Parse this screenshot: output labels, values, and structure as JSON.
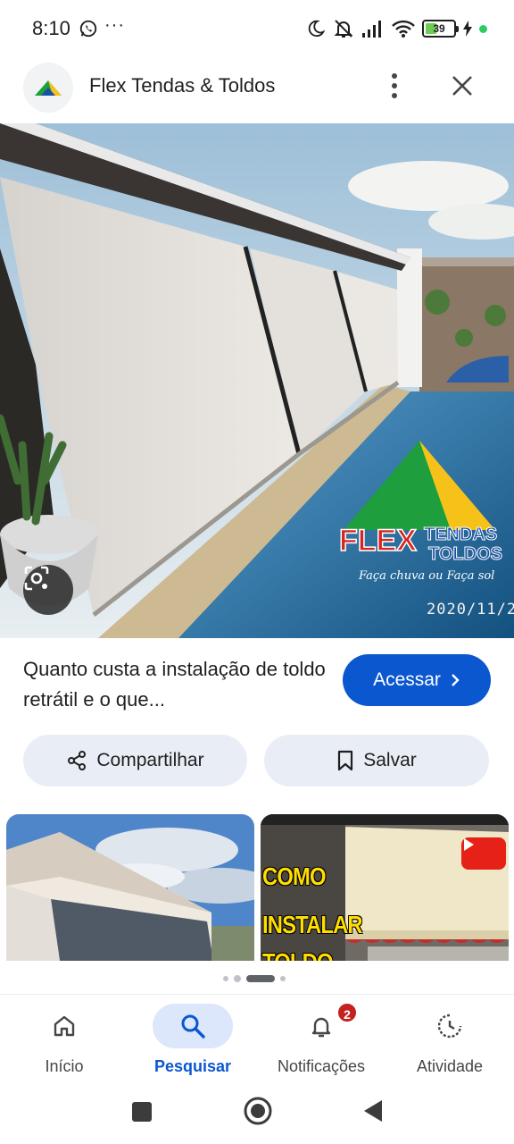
{
  "status_bar": {
    "time": "8:10",
    "more": "···",
    "battery_level": "39",
    "battery_fraction": 0.39
  },
  "header": {
    "title": "Flex Tendas & Toldos",
    "logo_icon": "flex-tendas-logo",
    "menu_icon": "more-vert-icon",
    "close_icon": "close-icon"
  },
  "hero": {
    "date_stamp": "2020/11/2",
    "watermark_text": "FLEX TENDAS & TOLDOS — Faça chuva ou Faça sol",
    "lens_icon": "lens-search-icon"
  },
  "result": {
    "caption": "Quanto custa a instalação de toldo retrátil e o que...",
    "visit_label": "Acessar",
    "visit_icon": "chevron-right-icon"
  },
  "actions": {
    "share_label": "Compartilhar",
    "save_label": "Salvar"
  },
  "related": {
    "thumb2_line1": "COMO",
    "thumb2_line2": "INSTALAR",
    "thumb2_line3": "TOLDO",
    "video_icon": "youtube-play-icon"
  },
  "bottom_nav": {
    "items": [
      {
        "label": "Início",
        "icon": "home-icon"
      },
      {
        "label": "Pesquisar",
        "icon": "search-icon"
      },
      {
        "label": "Notificações",
        "icon": "bell-icon",
        "badge": "2"
      },
      {
        "label": "Atividade",
        "icon": "activity-icon"
      }
    ],
    "active": "Pesquisar"
  },
  "colors": {
    "primary": "#0b57d0",
    "chip_bg": "#e9eef6",
    "badge": "#c5221f"
  }
}
